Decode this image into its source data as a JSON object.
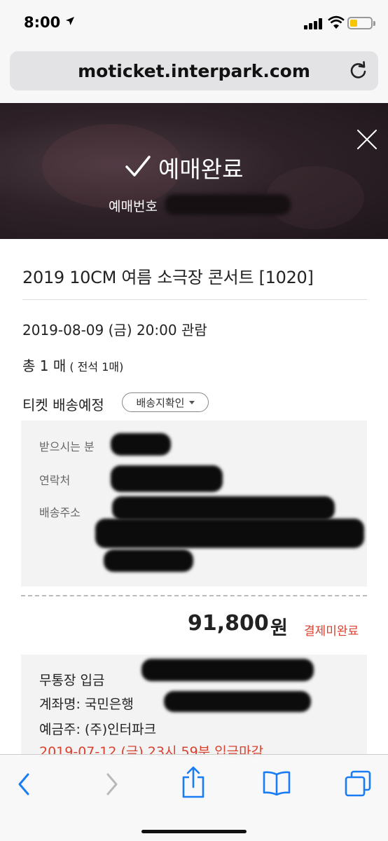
{
  "status_bar": {
    "time": "8:00"
  },
  "browser": {
    "url": "moticket.interpark.com"
  },
  "header": {
    "title": "예매완료",
    "booking_label": "예매번호"
  },
  "ticket": {
    "concert_title": "2019 10CM 여름 소극장 콘서트  [1020]",
    "date_line": "2019-08-09 (금) 20:00 관람",
    "count_main": "총 1 매",
    "count_sub": " ( 전석 1매)",
    "delivery_label": "티켓 배송예정",
    "delivery_button": "배송지확인"
  },
  "recipient": {
    "name_label": "받으시는 분",
    "phone_label": "연락처",
    "address_label": "배송주소"
  },
  "payment": {
    "amount": "91,800",
    "currency": "원",
    "status": "결제미완료",
    "method": "무통장 입금",
    "account_label": "계좌명: 국민은행",
    "holder": "예금주: (주)인터파크",
    "deadline": "2019-07-12 (금) 23시 59분 입금마감"
  },
  "colors": {
    "accent_red": "#d9412f",
    "ios_blue": "#1a7cf5"
  }
}
